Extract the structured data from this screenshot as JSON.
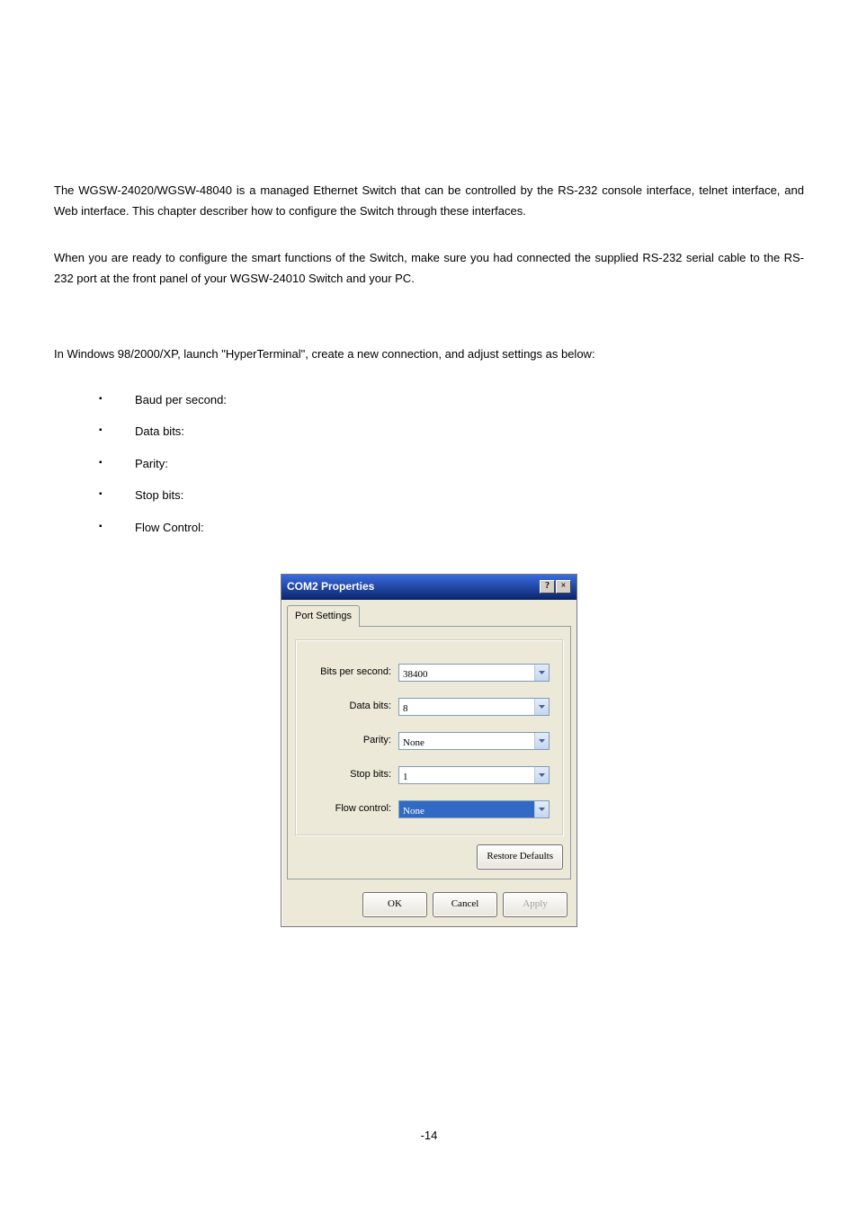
{
  "content": {
    "para1": "The WGSW-24020/WGSW-48040 is a managed Ethernet Switch that can be controlled by the RS-232 console interface, telnet interface, and Web interface. This chapter describer how to configure the Switch through these interfaces.",
    "para2": "When you are ready to configure the smart functions of the Switch, make sure you had connected the supplied RS-232 serial cable to the RS-232 port at the front panel of your WGSW-24010 Switch and your PC.",
    "setup_line": "In Windows 98/2000/XP, launch \"HyperTerminal\", create a new connection, and adjust settings as below:",
    "bullets": {
      "b0": "Baud per second:",
      "b1": "Data bits:",
      "b2": "Parity:",
      "b3": "Stop bits:",
      "b4": "Flow Control:"
    }
  },
  "dialog": {
    "title": "COM2 Properties",
    "help_btn": "?",
    "close_btn": "×",
    "tab": "Port Settings",
    "labels": {
      "bps": "Bits per second:",
      "databits": "Data bits:",
      "parity": "Parity:",
      "stopbits": "Stop bits:",
      "flow": "Flow control:"
    },
    "values": {
      "bps": "38400",
      "databits": "8",
      "parity": "None",
      "stopbits": "1",
      "flow": "None"
    },
    "buttons": {
      "restore": "Restore Defaults",
      "ok": "OK",
      "cancel": "Cancel",
      "apply": "Apply"
    }
  },
  "footer": {
    "page": "-14"
  }
}
